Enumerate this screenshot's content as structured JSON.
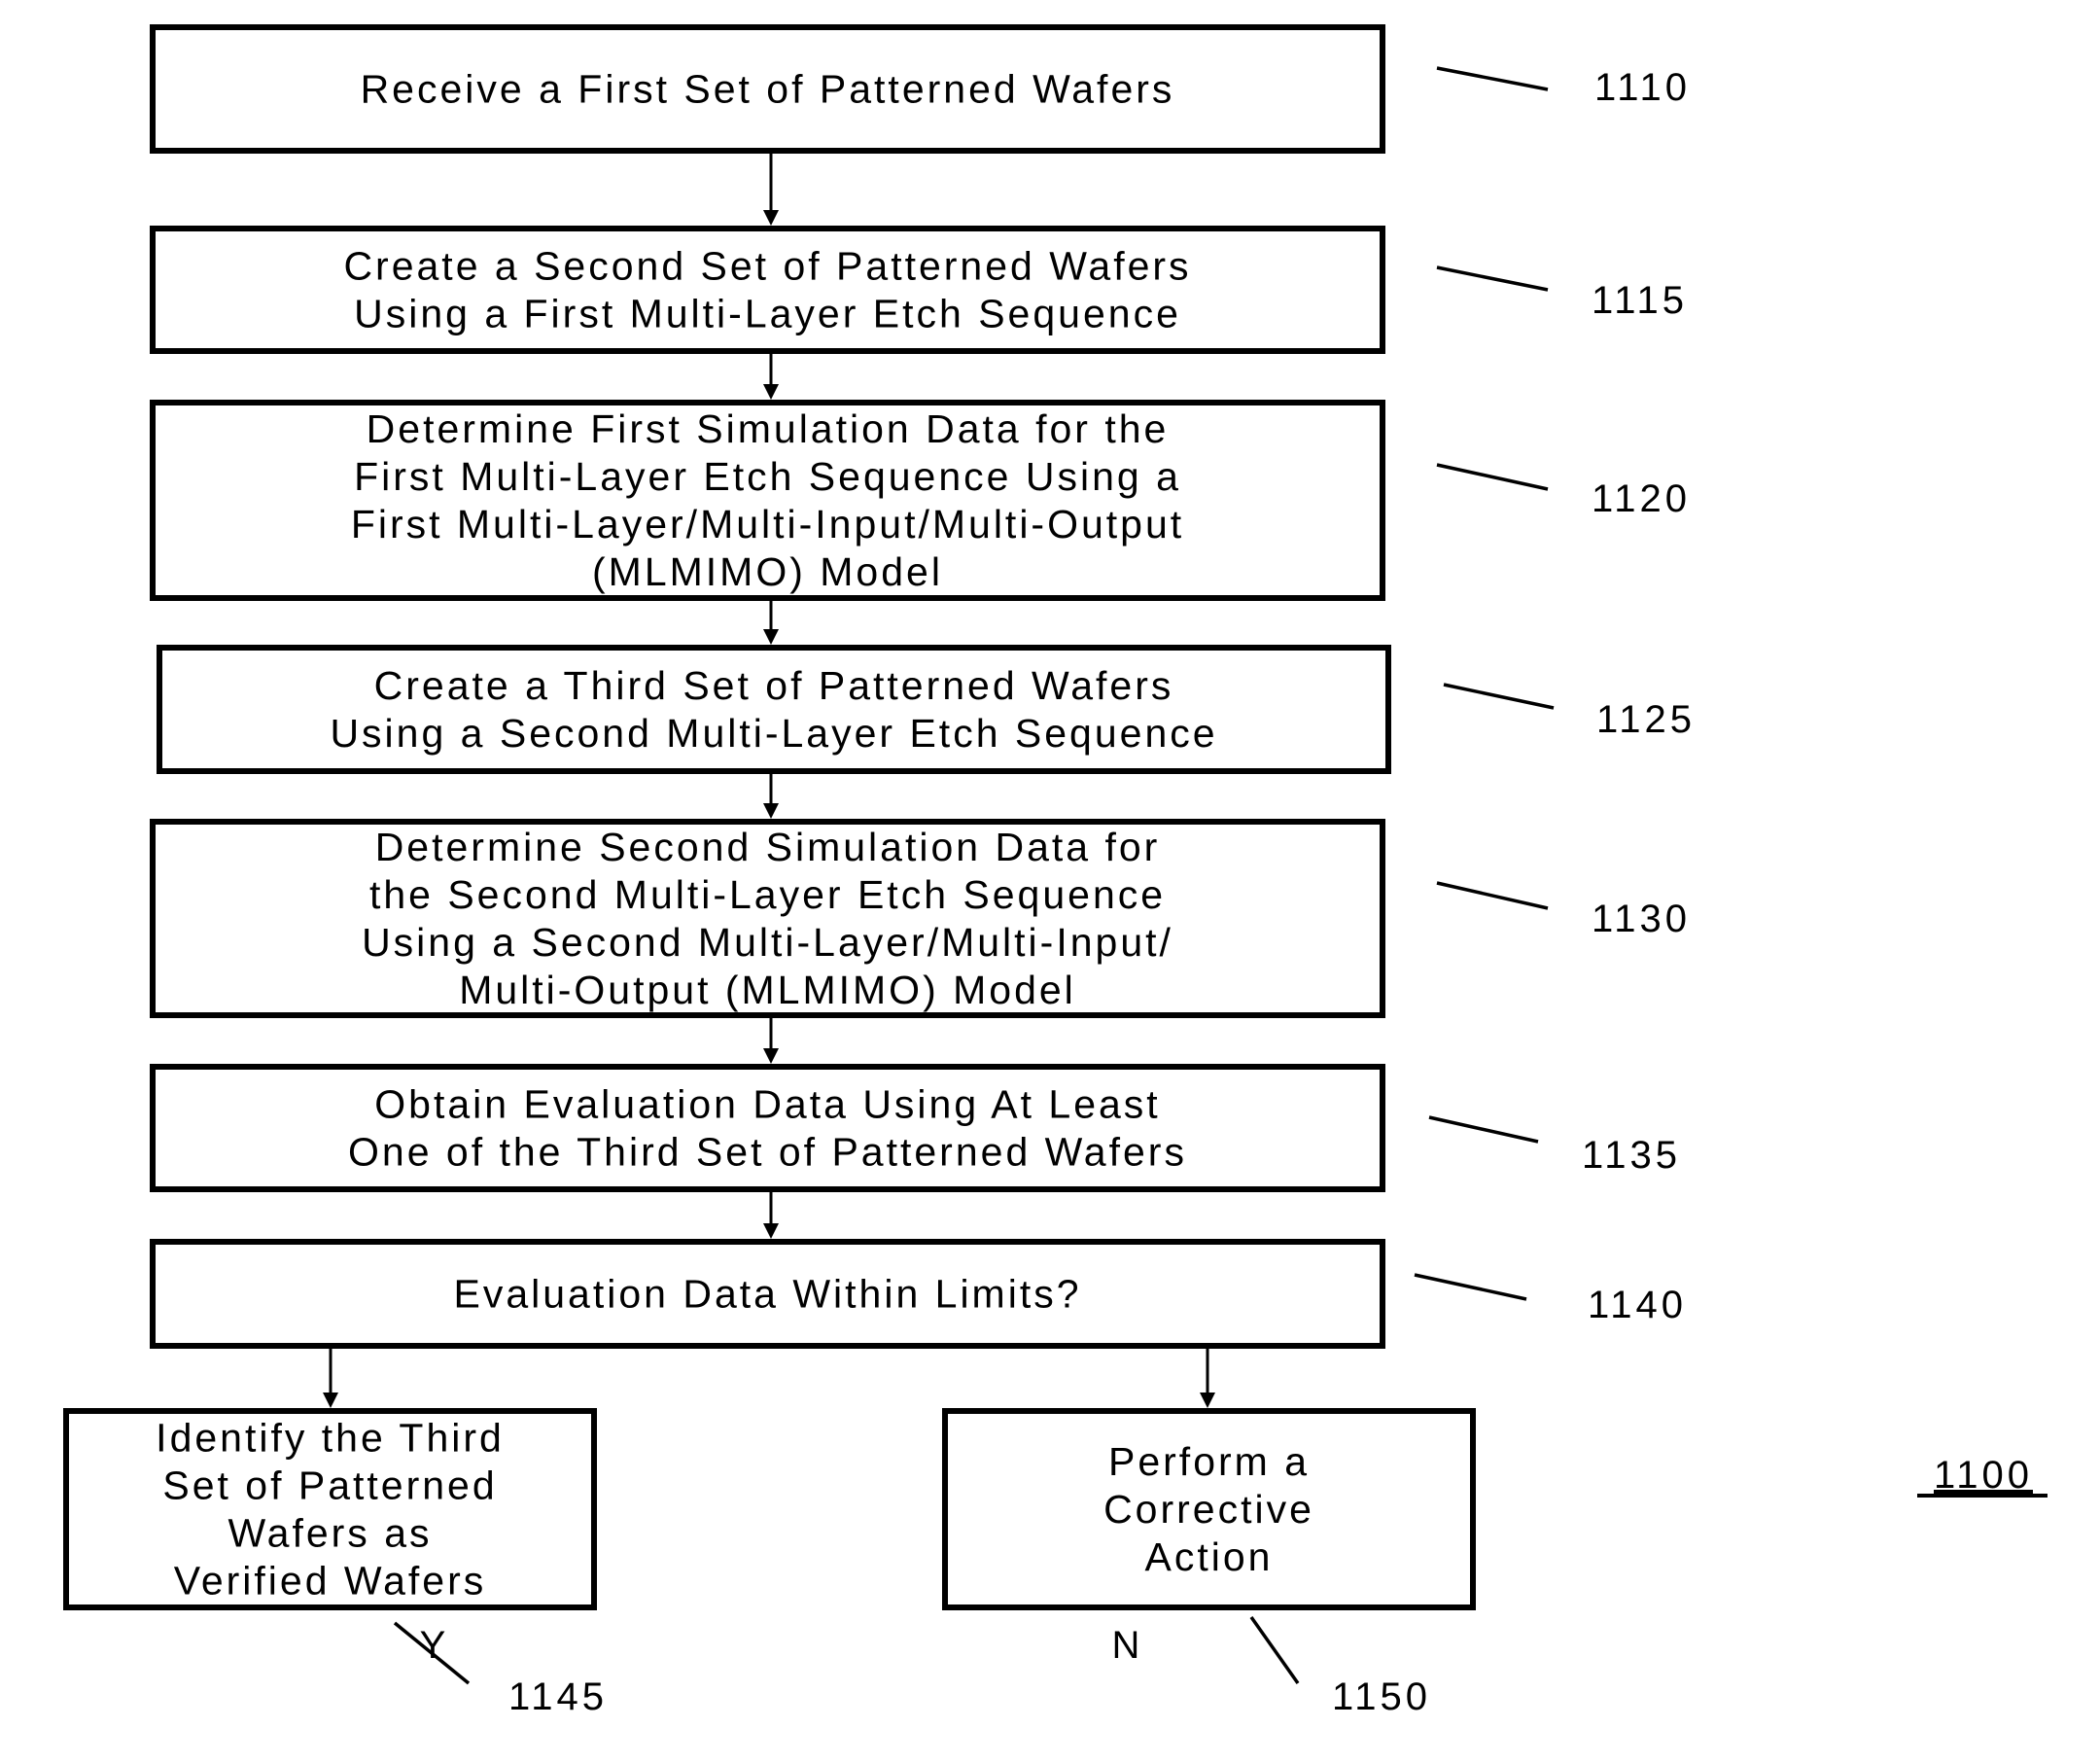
{
  "figure": {
    "label": "1100",
    "steps": [
      {
        "id": "1110",
        "lines": [
          "Receive a First Set of Patterned Wafers"
        ]
      },
      {
        "id": "1115",
        "lines": [
          "Create a Second Set of Patterned Wafers",
          "Using a First Multi-Layer Etch Sequence"
        ]
      },
      {
        "id": "1120",
        "lines": [
          "Determine First Simulation Data for the",
          "First Multi-Layer Etch Sequence Using a",
          "First Multi-Layer/Multi-Input/Multi-Output",
          "(MLMIMO) Model"
        ]
      },
      {
        "id": "1125",
        "lines": [
          "Create a Third Set of Patterned Wafers",
          "Using a Second Multi-Layer Etch Sequence"
        ]
      },
      {
        "id": "1130",
        "lines": [
          "Determine Second Simulation Data for",
          "the Second Multi-Layer Etch Sequence",
          "Using a Second Multi-Layer/Multi-Input/",
          "Multi-Output (MLMIMO) Model"
        ]
      },
      {
        "id": "1135",
        "lines": [
          "Obtain Evaluation Data Using At Least",
          "One of the Third Set of Patterned Wafers"
        ]
      },
      {
        "id": "1140",
        "lines": [
          "Evaluation Data Within Limits?"
        ]
      },
      {
        "id": "1145",
        "lines": [
          "Identify the Third",
          "Set of Patterned",
          "Wafers as",
          "Verified Wafers"
        ]
      },
      {
        "id": "1150",
        "lines": [
          "Perform a",
          "Corrective",
          "Action"
        ]
      }
    ],
    "branches": {
      "yes": "Y",
      "no": "N"
    }
  }
}
